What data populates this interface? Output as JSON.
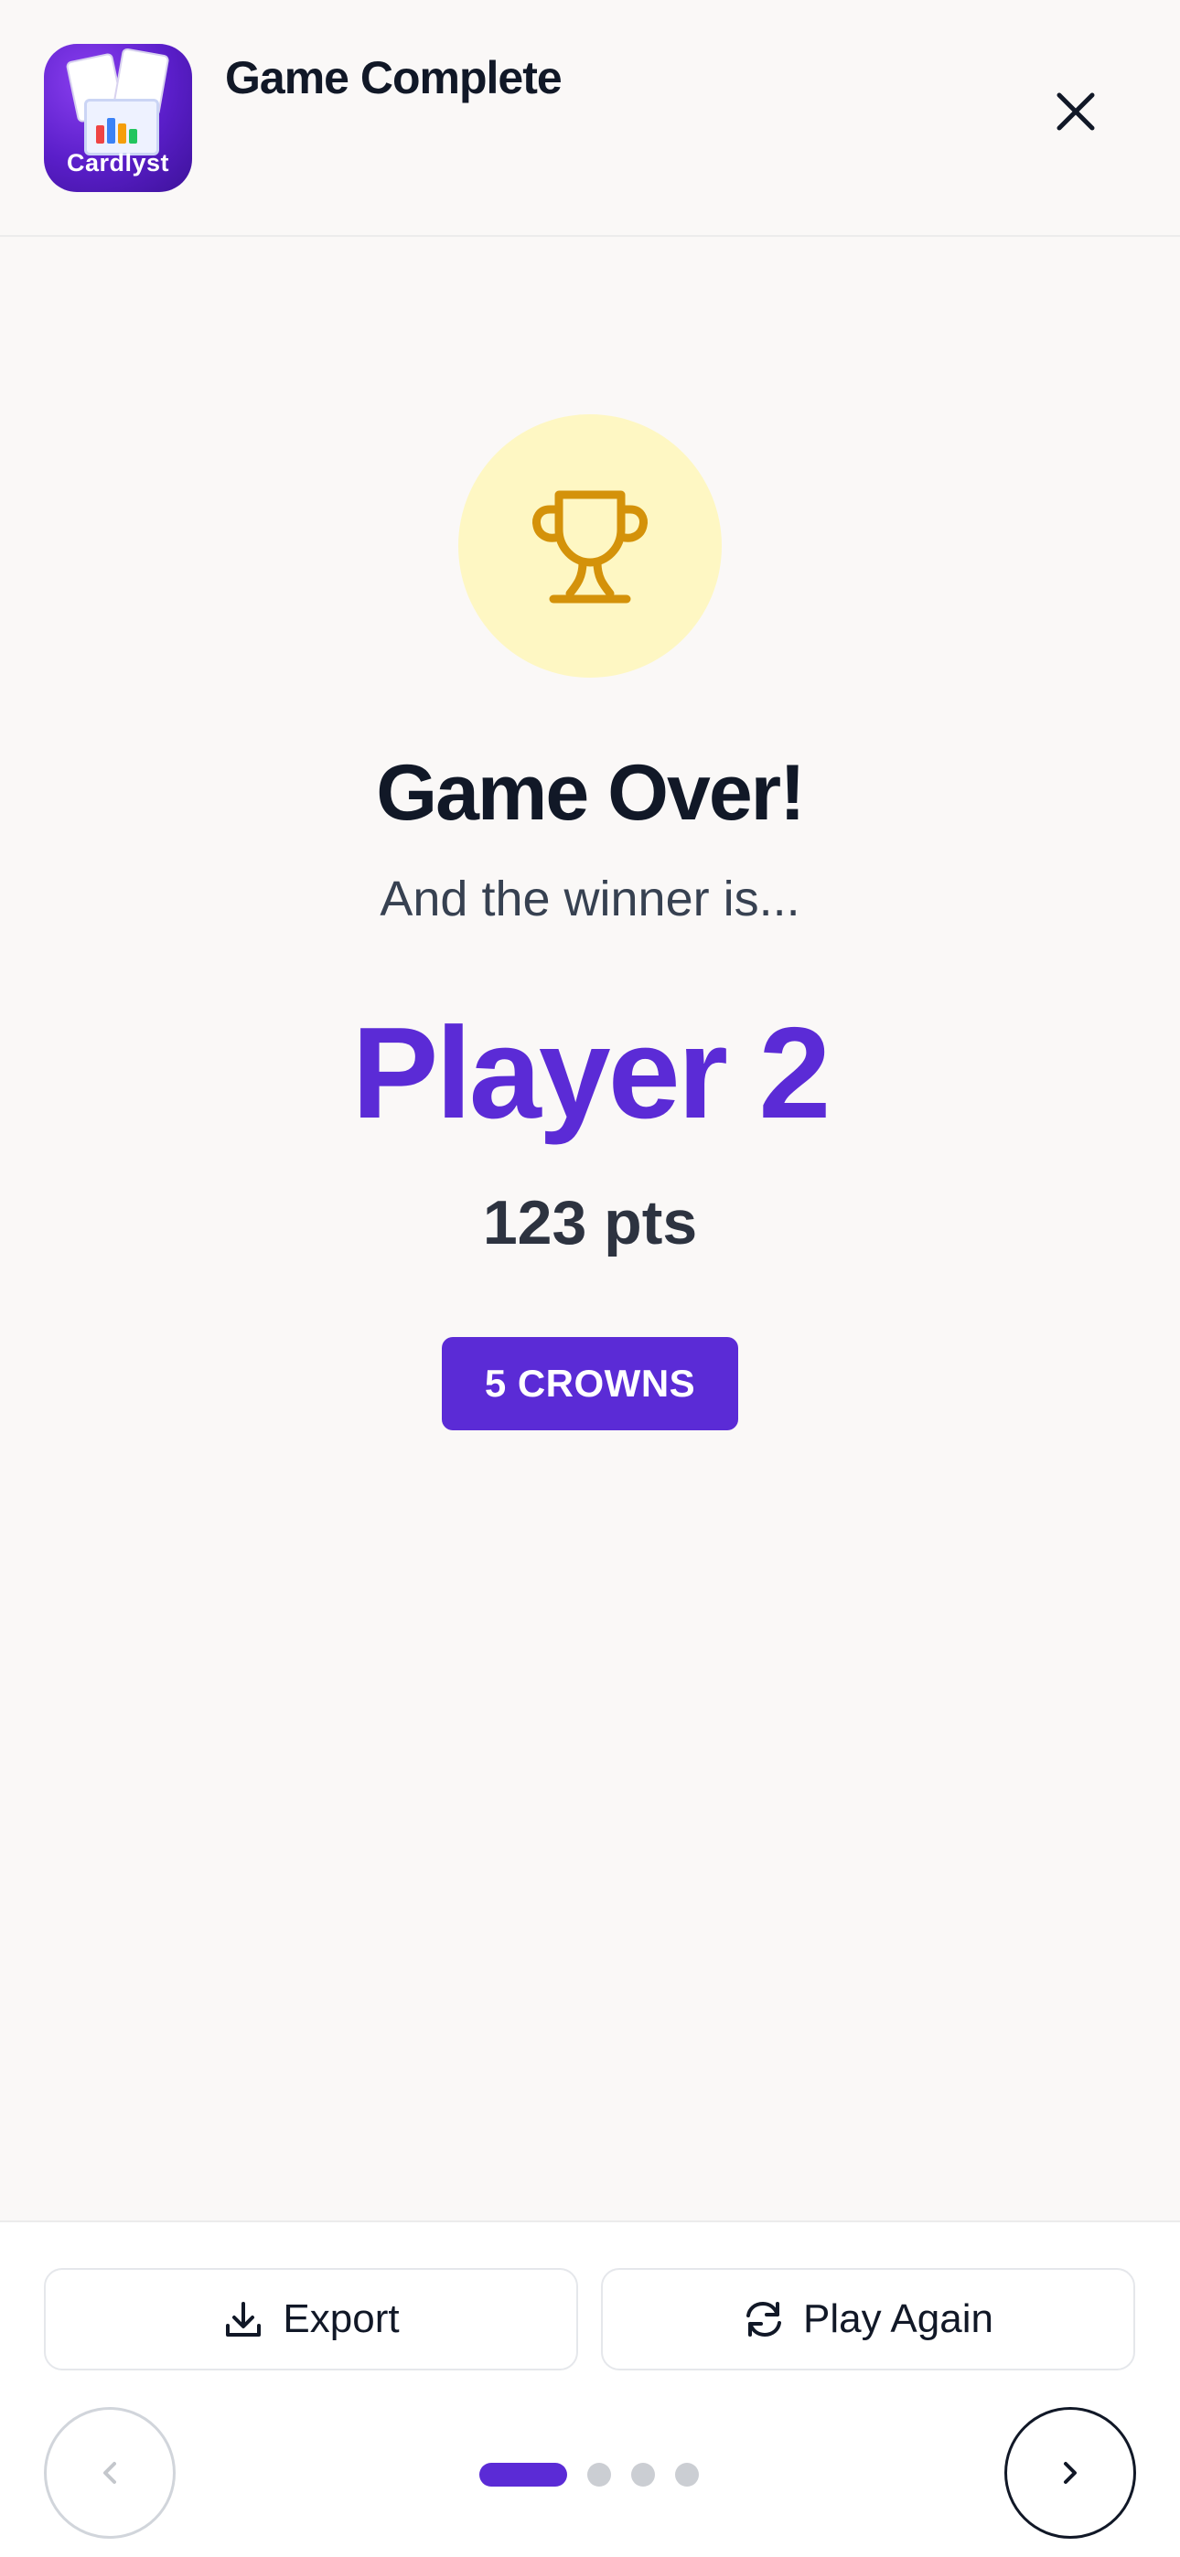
{
  "header": {
    "app_name": "Cardlyst",
    "title": "Game Complete",
    "close_icon": "close-icon"
  },
  "main": {
    "trophy_icon": "trophy-icon",
    "title": "Game Over!",
    "subtitle": "And the winner is...",
    "winner_name": "Player 2",
    "points": "123 pts",
    "badge": "5 CROWNS"
  },
  "footer": {
    "export_label": "Export",
    "play_again_label": "Play Again",
    "pagination": {
      "total": 4,
      "current": 1
    }
  },
  "colors": {
    "accent": "#5b2bd6",
    "trophy": "#d4920a",
    "trophy_bg": "#fef7c3",
    "background": "#faf8f7"
  }
}
